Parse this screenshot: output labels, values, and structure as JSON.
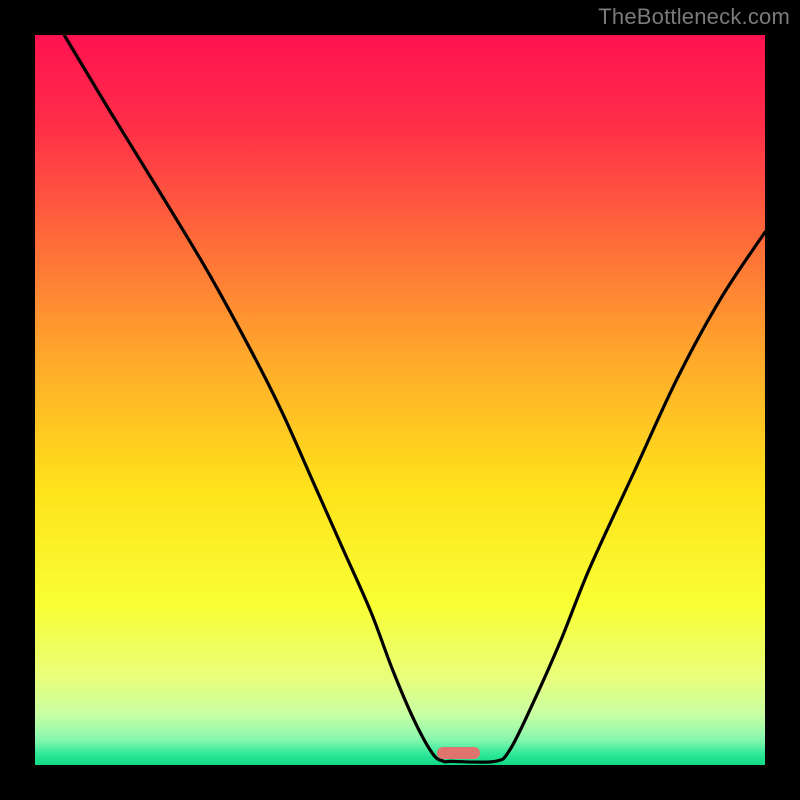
{
  "attribution": "TheBottleneck.com",
  "colors": {
    "frame_bg": "#000000",
    "attribution_text": "#7a7a7a",
    "curve": "#000000",
    "marker": "#e0736e",
    "gradient_stops": [
      {
        "offset": 0.0,
        "color": "#ff1250"
      },
      {
        "offset": 0.12,
        "color": "#ff2d49"
      },
      {
        "offset": 0.28,
        "color": "#ff6a3a"
      },
      {
        "offset": 0.44,
        "color": "#ffa82b"
      },
      {
        "offset": 0.62,
        "color": "#ffe21b"
      },
      {
        "offset": 0.78,
        "color": "#f9ff34"
      },
      {
        "offset": 0.88,
        "color": "#e8ff7b"
      },
      {
        "offset": 0.93,
        "color": "#c9ffa3"
      },
      {
        "offset": 0.965,
        "color": "#88f7ae"
      },
      {
        "offset": 0.985,
        "color": "#2fe89a"
      },
      {
        "offset": 1.0,
        "color": "#10d985"
      }
    ]
  },
  "chart_data": {
    "type": "line",
    "title": "",
    "xlabel": "",
    "ylabel": "",
    "xlim": [
      0,
      100
    ],
    "ylim": [
      0,
      100
    ],
    "grid": false,
    "legend": false,
    "series": [
      {
        "name": "bottleneck-curve",
        "x": [
          4,
          10,
          18,
          24,
          30,
          34,
          38,
          42,
          46,
          49,
          52,
          54.5,
          56,
          57,
          63,
          65,
          68,
          72,
          76,
          82,
          88,
          94,
          100
        ],
        "y": [
          100,
          90,
          77,
          67,
          56,
          48,
          39,
          30,
          21,
          13,
          6,
          1.5,
          0.5,
          0.5,
          0.5,
          2,
          8,
          17,
          27,
          40,
          53,
          64,
          73
        ]
      }
    ],
    "marker": {
      "x_center": 58,
      "y": 0.8,
      "width_pct": 6,
      "height_pct": 1.6
    },
    "notes": "Values are percentages of the plot area; y=0 is bottom (green), y=100 is top (red). Estimated from pixel positions."
  }
}
